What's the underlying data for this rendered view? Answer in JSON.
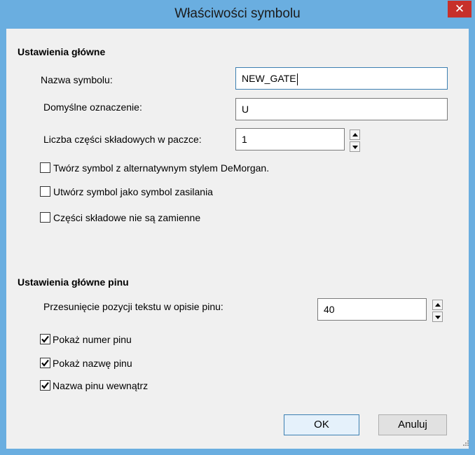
{
  "window": {
    "title": "Właściwości symbolu",
    "close_glyph": "✕"
  },
  "main_settings": {
    "heading": "Ustawienia główne",
    "name_label": "Nazwa symbolu:",
    "name_value": "NEW_GATE",
    "designator_label": "Domyślne oznaczenie:",
    "designator_value": "U",
    "parts_label": "Liczba części składowych w paczce:",
    "parts_value": "1",
    "checkboxes": [
      {
        "label": "Twórz symbol z alternatywnym stylem DeMorgan.",
        "checked": false
      },
      {
        "label": "Utwórz symbol jako symbol zasilania",
        "checked": false
      },
      {
        "label": "Części składowe nie są zamienne",
        "checked": false
      }
    ]
  },
  "pin_settings": {
    "heading": "Ustawienia główne pinu",
    "offset_label": "Przesunięcie pozycji tekstu w opisie pinu:",
    "offset_value": "40",
    "checkboxes": [
      {
        "label": "Pokaż numer pinu",
        "checked": true
      },
      {
        "label": "Pokaż nazwę pinu",
        "checked": true
      },
      {
        "label": "Nazwa pinu wewnątrz",
        "checked": true
      }
    ]
  },
  "buttons": {
    "ok": "OK",
    "cancel": "Anuluj"
  },
  "colors": {
    "titlebar": "#6aaee0",
    "close": "#c7302a",
    "client": "#f0f0f0",
    "focus_border": "#3c7fb1"
  }
}
